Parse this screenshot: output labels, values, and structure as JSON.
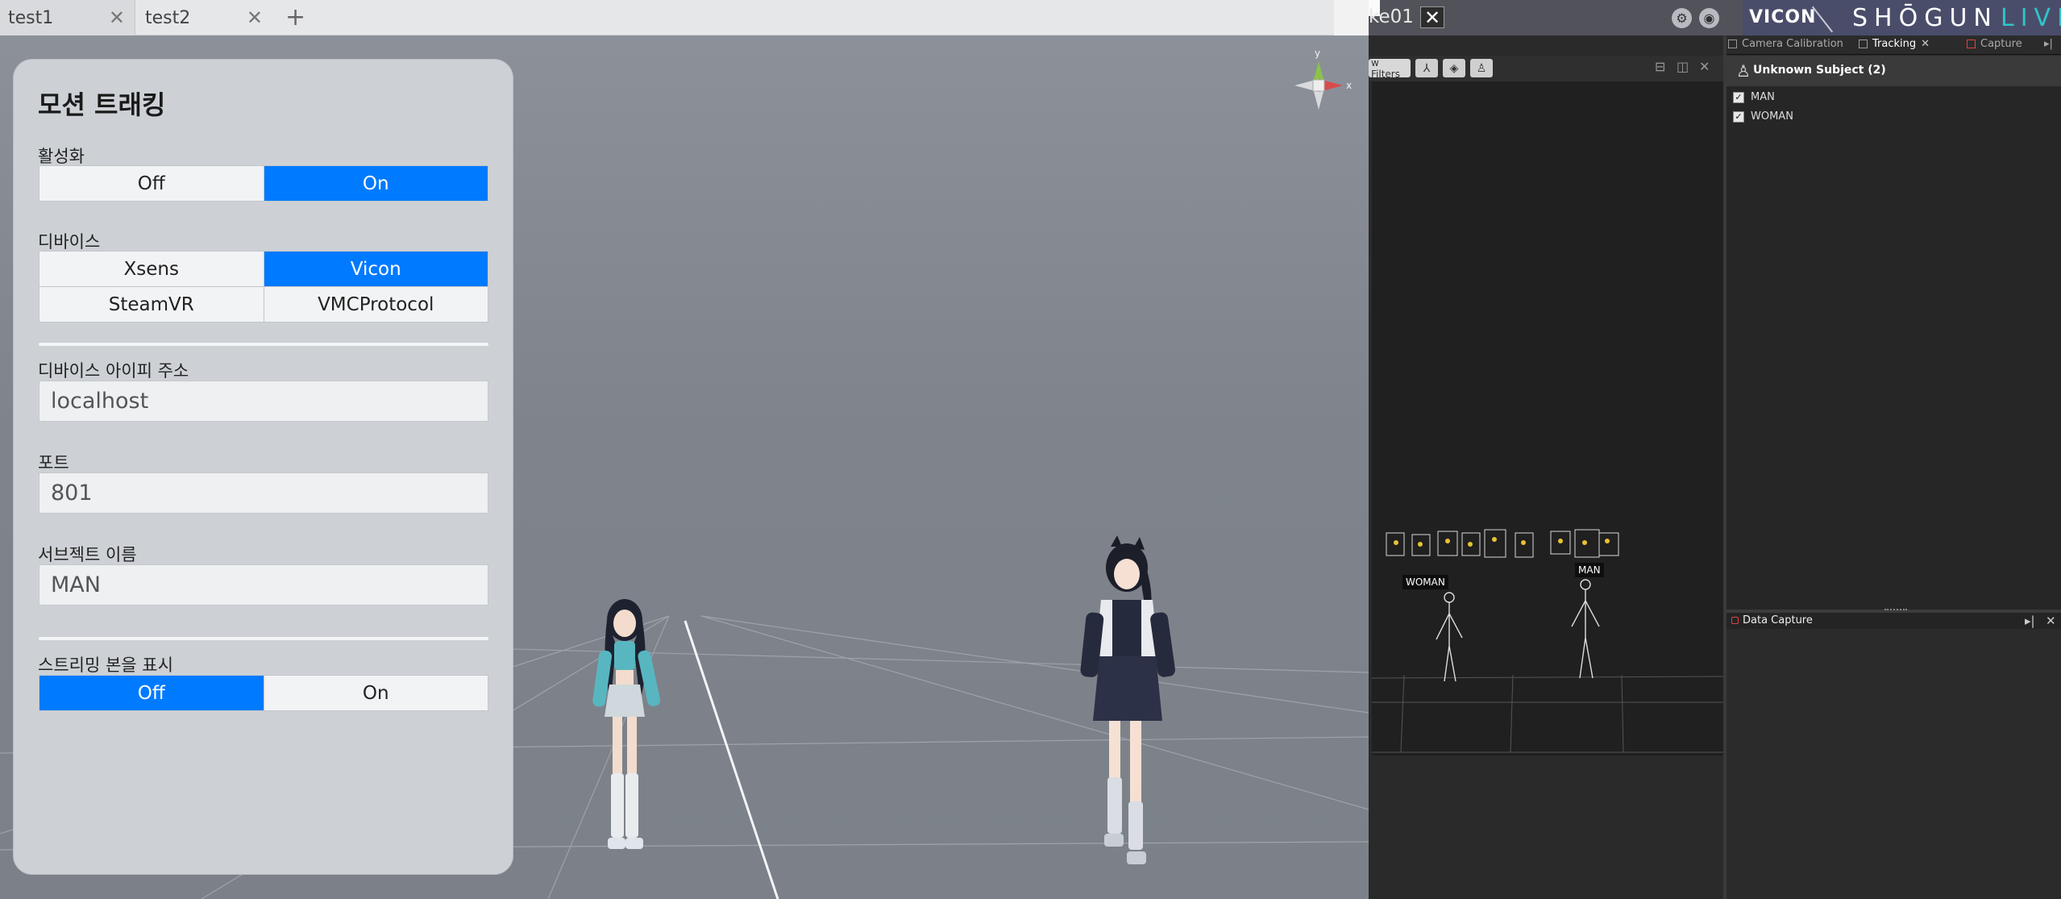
{
  "tabs": [
    {
      "label": "test1"
    },
    {
      "label": "test2"
    }
  ],
  "panel": {
    "title": "모션 트래킹",
    "activation": {
      "label": "활성화",
      "options": [
        "Off",
        "On"
      ],
      "selected": "On"
    },
    "device": {
      "label": "디바이스",
      "options": [
        "Xsens",
        "Vicon",
        "SteamVR",
        "VMCProtocol"
      ],
      "selected": "Vicon"
    },
    "ip": {
      "label": "디바이스 아이피 주소",
      "value": "localhost"
    },
    "port": {
      "label": "포트",
      "value": "801"
    },
    "subject": {
      "label": "서브젝트 이름",
      "value": "MAN"
    },
    "show_bones": {
      "label": "스트리밍 본을 표시",
      "options": [
        "Off",
        "On"
      ],
      "selected": "Off"
    }
  },
  "gizmo": {
    "y": "y",
    "x": "x"
  },
  "shogun": {
    "doc_title": "ke01",
    "brand_vicon": "VICON",
    "brand_shogun": "SHŌGUN",
    "brand_live": "LIVE",
    "tabs": [
      {
        "label": "Camera Calibration"
      },
      {
        "label": "Tracking"
      },
      {
        "label": "Capture"
      }
    ],
    "view_filters": "w Filters",
    "scene_labels": {
      "woman": "WOMAN",
      "man": "MAN"
    },
    "tracking": {
      "group": "Unknown Subject (2)",
      "subjects": [
        {
          "name": "MAN",
          "checked": true
        },
        {
          "name": "WOMAN",
          "checked": true
        }
      ]
    },
    "data_capture": {
      "title": "Data Capture"
    }
  },
  "colors": {
    "accent": "#007aff",
    "viewport_bg": "#858a92",
    "shogun_live": "#2ec4c8",
    "shogun_brand_bg": "#4a4d6a"
  },
  "icons": [
    "close-icon",
    "plus-icon",
    "gear-icon",
    "eye-icon",
    "person-icon",
    "checkbox-icon",
    "pin-icon"
  ]
}
